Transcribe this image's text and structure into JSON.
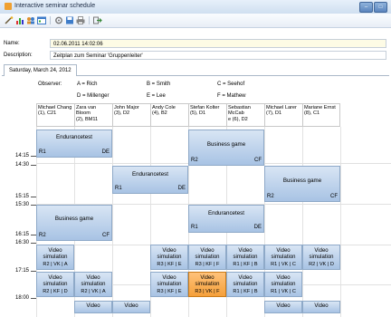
{
  "window": {
    "title": "Interactive seminar schedule",
    "minimize": "–",
    "maximize": "□"
  },
  "toolbar": {
    "icons": [
      "wand-icon",
      "bar-chart-icon",
      "users-icon",
      "calendar-icon",
      "settings-icon",
      "save-icon",
      "print-icon",
      "exit-icon"
    ]
  },
  "form": {
    "name_label": "Name:",
    "name_value": "02.06.2011 14:02:06",
    "description_label": "Description:",
    "description_value": "Zeitplan zum Seminar 'Gruppenleiter'"
  },
  "tab": {
    "label": "Saturday, March 24, 2012"
  },
  "legend": {
    "observer_label": "Observer:",
    "items": [
      "A = Rich",
      "B = Smith",
      "C = Seehof",
      "D = Millenger",
      "E = Lee",
      "F = Mathew"
    ]
  },
  "columns": [
    {
      "name": "Michael Chang",
      "info": "(1), C21"
    },
    {
      "name": "Zara van Bloom",
      "info": "(2), BM11"
    },
    {
      "name": "John Major",
      "info": "(3), D2"
    },
    {
      "name": "Andy Cole",
      "info": "(4), B2"
    },
    {
      "name": "Stefan Kolter",
      "info": "(5), D1"
    },
    {
      "name": "Sebastian McCab",
      "info": "e (6), D2"
    },
    {
      "name": "Michael Larer",
      "info": "(7), D1"
    },
    {
      "name": "Mariane Ernst",
      "info": "(8), C1"
    }
  ],
  "times": [
    "14:15",
    "14:30",
    "15:15",
    "15:30",
    "16:15",
    "16:30",
    "17:15",
    "18:00"
  ],
  "events": {
    "e1": {
      "name": "Endurancetest",
      "room": "R1",
      "tag": "DE"
    },
    "e2": {
      "name": "Business game",
      "room": "R2",
      "tag": "CF"
    },
    "e3": {
      "name": "Endurancetest",
      "room": "R1",
      "tag": "DE"
    },
    "e4": {
      "name": "Business game",
      "room": "R2",
      "tag": "CF"
    },
    "e5": {
      "name": "Business game",
      "room": "R2",
      "tag": "CF"
    },
    "e6": {
      "name": "Endurancetest",
      "room": "R1",
      "tag": "DE"
    },
    "v1": {
      "name": "Video simulation",
      "sub": "R2 | VK | A"
    },
    "v2": {
      "name": "Video simulation",
      "sub": "R3 | KF | E"
    },
    "v3": {
      "name": "Video simulation",
      "sub": "R3 | KF | F"
    },
    "v4": {
      "name": "Video simulation",
      "sub": "R1 | KF | B"
    },
    "v5": {
      "name": "Video simulation",
      "sub": "R1 | VK | C"
    },
    "v6": {
      "name": "Video simulation",
      "sub": "R2 | VK | D"
    },
    "v7": {
      "name": "Video simulation",
      "sub": "R2 | KF | D"
    },
    "v8": {
      "name": "Video simulation",
      "sub": "R2 | VK | A"
    },
    "v9": {
      "name": "Video simulation",
      "sub": "R3 | KF | E"
    },
    "v10": {
      "name": "Video simulation",
      "sub": "R3 | VK | F"
    },
    "v11": {
      "name": "Video simulation",
      "sub": "R1 | KF | B"
    },
    "v12": {
      "name": "Video simulation",
      "sub": "R1 | VK | C"
    },
    "v13": {
      "name": "Video",
      "sub": ""
    },
    "v14": {
      "name": "Video",
      "sub": ""
    },
    "v15": {
      "name": "Video",
      "sub": ""
    },
    "v16": {
      "name": "Video",
      "sub": ""
    }
  },
  "colors": {
    "event": "#b8cfea",
    "selected_event": "#f5a03a",
    "titlebar": "#dce8f5"
  }
}
